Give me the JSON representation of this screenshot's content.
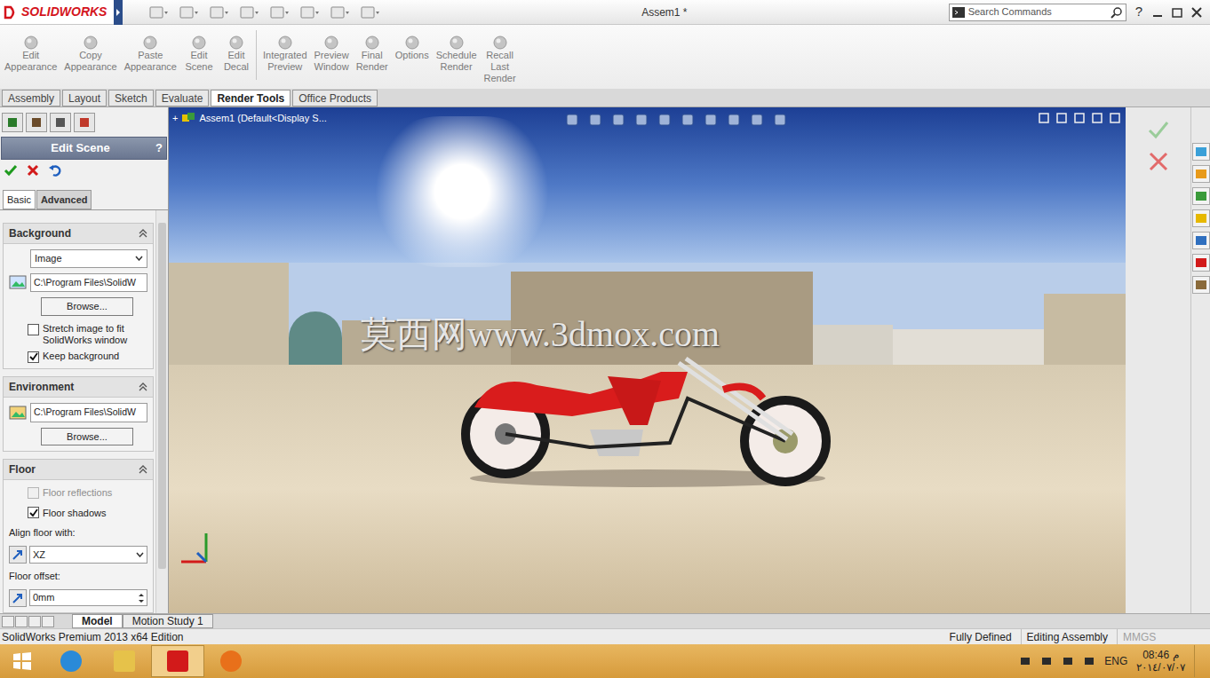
{
  "window": {
    "logo": "SOLIDWORKS",
    "title": "Assem1 *",
    "search_placeholder": "Search Commands",
    "help": "?"
  },
  "ribbon": [
    {
      "lines": [
        "Edit",
        "Appearance"
      ]
    },
    {
      "lines": [
        "Copy",
        "Appearance"
      ]
    },
    {
      "lines": [
        "Paste",
        "Appearance"
      ]
    },
    {
      "lines": [
        "Edit",
        "Scene"
      ]
    },
    {
      "lines": [
        "Edit",
        "Decal"
      ]
    },
    {
      "lines": [
        "Integrated",
        "Preview"
      ]
    },
    {
      "lines": [
        "Preview",
        "Window"
      ]
    },
    {
      "lines": [
        "Final",
        "Render"
      ]
    },
    {
      "lines": [
        "Options"
      ]
    },
    {
      "lines": [
        "Schedule",
        "Render"
      ]
    },
    {
      "lines": [
        "Recall",
        "Last",
        "Render"
      ]
    }
  ],
  "tabs": [
    {
      "label": "Assembly",
      "selected": false
    },
    {
      "label": "Layout",
      "selected": false
    },
    {
      "label": "Sketch",
      "selected": false
    },
    {
      "label": "Evaluate",
      "selected": false
    },
    {
      "label": "Render Tools",
      "selected": true
    },
    {
      "label": "Office Products",
      "selected": false
    }
  ],
  "property_manager": {
    "title": "Edit Scene",
    "help": "?",
    "subtabs": [
      {
        "label": "Basic",
        "selected": true
      },
      {
        "label": "Advanced",
        "selected": false
      }
    ],
    "background": {
      "title": "Background",
      "type": "Image",
      "path": "C:\\Program Files\\SolidW",
      "browse": "Browse...",
      "checkboxes": [
        {
          "label": "Stretch image to fit SolidWorks window",
          "checked": false,
          "disabled": false
        },
        {
          "label": "Keep background",
          "checked": true,
          "disabled": false
        }
      ]
    },
    "environment": {
      "title": "Environment",
      "path": "C:\\Program Files\\SolidW",
      "browse": "Browse..."
    },
    "floor": {
      "title": "Floor",
      "checkboxes": [
        {
          "label": "Floor reflections",
          "checked": false,
          "disabled": true
        },
        {
          "label": "Floor shadows",
          "checked": true,
          "disabled": false
        }
      ],
      "align_label": "Align floor with:",
      "align_value": "XZ",
      "offset_label": "Floor offset:",
      "offset_value": "0mm"
    }
  },
  "viewport": {
    "tree_label": "Assem1  (Default<Display S...",
    "watermark": "莫西网www.3dmox.com"
  },
  "bottom_tabs": [
    {
      "label": "Model",
      "selected": true
    },
    {
      "label": "Motion Study 1",
      "selected": false
    }
  ],
  "status_bar": {
    "edition": "SolidWorks Premium 2013 x64 Edition",
    "items": [
      {
        "label": "Fully Defined",
        "disabled": false
      },
      {
        "label": "Editing Assembly",
        "disabled": false
      },
      {
        "label": "MMGS",
        "disabled": true
      }
    ]
  },
  "taskbar": {
    "language": "ENG",
    "time": "08:46",
    "period": "م",
    "date": "٢٠١٤/٠٧/٠٧"
  }
}
